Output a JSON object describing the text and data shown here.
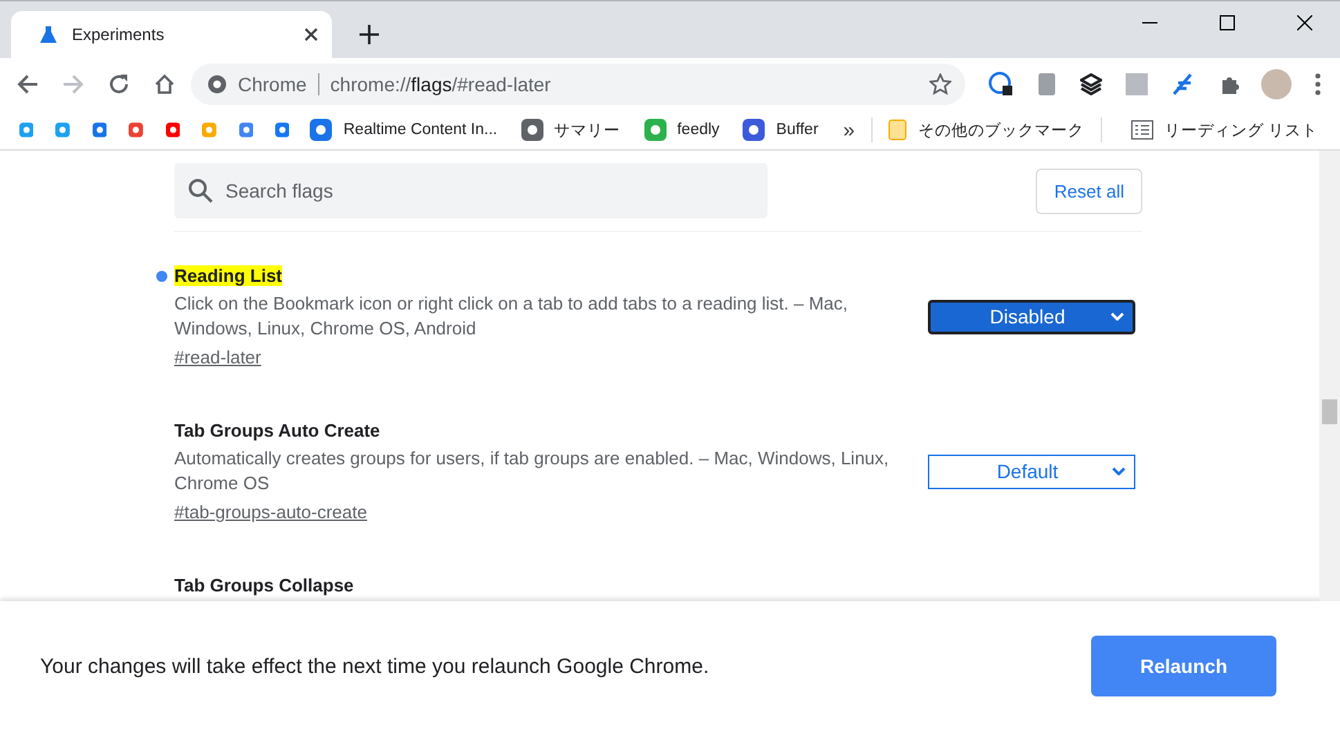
{
  "tabs": [
    {
      "title": "Experiments",
      "selected": true
    }
  ],
  "toolbar": {
    "site_label": "Chrome",
    "url": "chrome://**flags**/#read-later",
    "forward_disabled": true
  },
  "bookmarks": [
    {
      "label": "Realtime Content In..."
    },
    {
      "label": "サマリー"
    },
    {
      "label": "feedly"
    },
    {
      "label": "Buffer"
    }
  ],
  "bookmarks_overflow": "»",
  "bookmarks_right": [
    {
      "label": "その他のブックマーク"
    },
    {
      "label": "リーディング リスト"
    }
  ],
  "search": {
    "placeholder": "Search flags"
  },
  "reset_button": "Reset all",
  "flags": [
    {
      "name": "Reading List",
      "highlighted": true,
      "modified": true,
      "description": "Click on the Bookmark icon or right click on a tab to add tabs to a reading list. – Mac, Windows, Linux, Chrome OS, Android",
      "link": "#read-later",
      "value": "Disabled",
      "focused": true
    },
    {
      "name": "Tab Groups Auto Create",
      "highlighted": false,
      "modified": false,
      "description": "Automatically creates groups for users, if tab groups are enabled. – Mac, Windows, Linux, Chrome OS",
      "link": "#tab-groups-auto-create",
      "value": "Default",
      "focused": false
    },
    {
      "name": "Tab Groups Collapse",
      "highlighted": false,
      "modified": false
    }
  ],
  "footer": {
    "message": "Your changes will take effect the next time you relaunch Google Chrome.",
    "button": "Relaunch"
  }
}
